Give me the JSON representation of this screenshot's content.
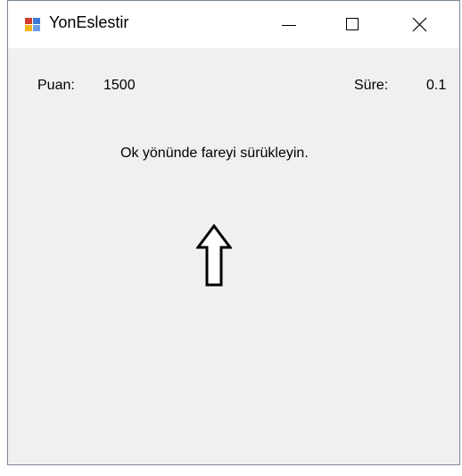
{
  "window": {
    "title": "YonEslestir"
  },
  "score": {
    "label": "Puan:",
    "value": "1500"
  },
  "time": {
    "label": "Süre:",
    "value": "0.1"
  },
  "instruction": "Ok yönünde fareyi sürükleyin.",
  "arrow": {
    "direction": "up",
    "icon": "up-arrow-outline-icon"
  },
  "titlebar_buttons": {
    "minimize_icon": "minimize-icon",
    "maximize_icon": "maximize-icon",
    "close_icon": "close-icon"
  }
}
